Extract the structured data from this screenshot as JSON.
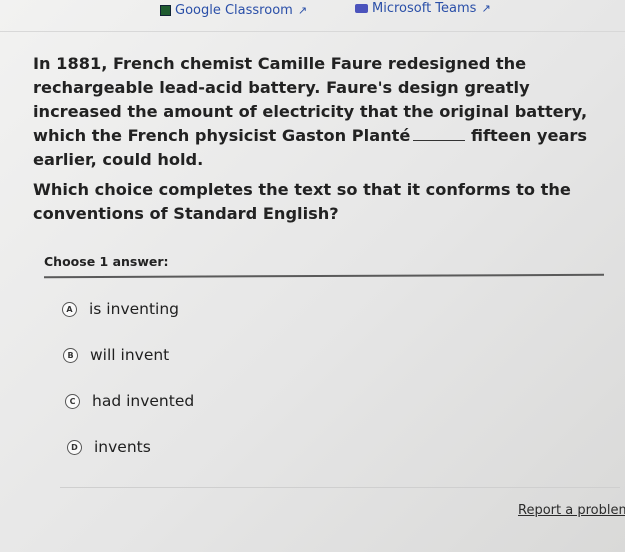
{
  "top_links": {
    "google_classroom": "Google Classroom",
    "microsoft_teams": "Microsoft Teams"
  },
  "passage": {
    "text": "In 1881, French chemist Camille Faure redesigned the rechargeable lead-acid battery. Faure's design greatly increased the amount of electricity that the original battery, which the French physicist Gaston Planté",
    "after_blank": "fifteen years earlier, could hold."
  },
  "question": "Which choice completes the text so that it conforms to the conventions of Standard English?",
  "choose_label": "Choose 1 answer:",
  "choices": [
    {
      "letter": "A",
      "text": "is inventing"
    },
    {
      "letter": "B",
      "text": "will invent"
    },
    {
      "letter": "C",
      "text": "had invented"
    },
    {
      "letter": "D",
      "text": "invents"
    }
  ],
  "report_link": "Report a problem",
  "icons": {
    "classroom": "google-classroom-icon",
    "teams": "microsoft-teams-icon",
    "external": "external-link-icon"
  },
  "colors": {
    "link": "#2a4fa8",
    "text": "#222222"
  }
}
